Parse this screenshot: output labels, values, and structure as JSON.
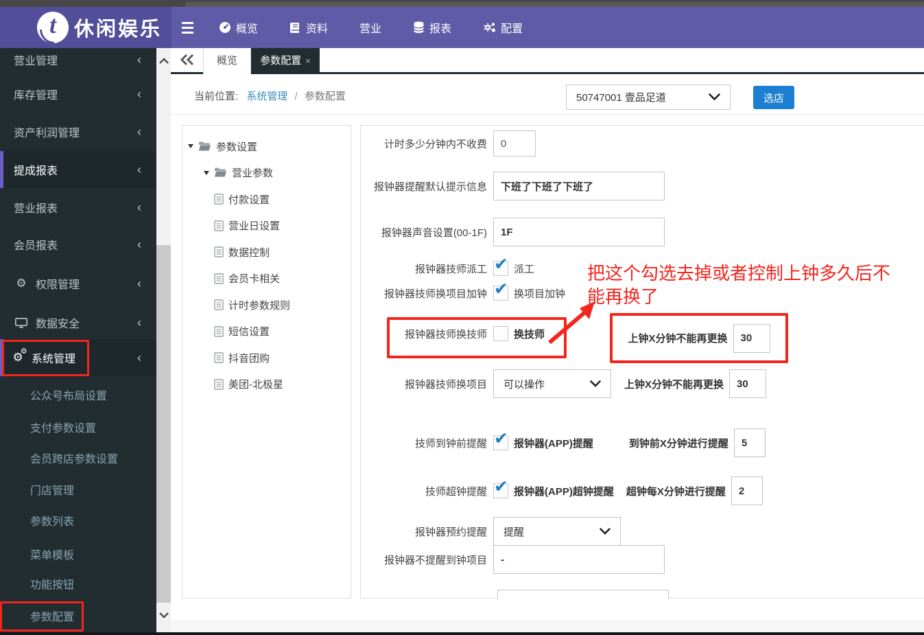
{
  "navbar": {
    "brand": "休闲娱乐",
    "items": [
      {
        "label": "概览",
        "icon": "dashboard-icon"
      },
      {
        "label": "资料",
        "icon": "book-icon"
      },
      {
        "label": "营业",
        "icon": ""
      },
      {
        "label": "报表",
        "icon": "database-icon"
      },
      {
        "label": "配置",
        "icon": "gears-icon"
      }
    ]
  },
  "sidebar": {
    "items": [
      {
        "label": "营业管理"
      },
      {
        "label": "库存管理"
      },
      {
        "label": "资产利润管理"
      },
      {
        "label": "提成报表",
        "active": true
      },
      {
        "label": "营业报表"
      },
      {
        "label": "会员报表"
      },
      {
        "label": "权限管理",
        "icon": "gear-icon"
      },
      {
        "label": "数据安全",
        "icon": "monitor-icon"
      },
      {
        "label": "系统管理",
        "icon": "gears-icon",
        "active": true,
        "highlighted": true
      }
    ],
    "chevron": "‹",
    "submenu": [
      {
        "label": "公众号布局设置"
      },
      {
        "label": "支付参数设置"
      },
      {
        "label": "会员跨店参数设置"
      },
      {
        "label": "门店管理"
      },
      {
        "label": "参数列表"
      },
      {
        "label": "菜单模板"
      },
      {
        "label": "功能按钮"
      },
      {
        "label": "参数配置",
        "highlighted": true
      }
    ]
  },
  "tabs": {
    "tab1": {
      "label": "概览"
    },
    "tab2": {
      "label": "参数配置",
      "close": "×",
      "active": true
    }
  },
  "breadcrumb": {
    "prefix": "当前位置:",
    "link": "系统管理",
    "separator": "/",
    "current": "参数配置"
  },
  "store": {
    "selected": "50747001 壹品足道",
    "button": "选店"
  },
  "tree": {
    "root": "参数设置",
    "group": "营业参数",
    "leaves": [
      "付款设置",
      "营业日设置",
      "数据控制",
      "会员卡相关",
      "计时参数规则",
      "短信设置",
      "抖音团购",
      "美团-北极星"
    ]
  },
  "form": {
    "free_minutes": {
      "label": "计时多少分钟内不收费",
      "value": "0"
    },
    "default_message": {
      "label": "报钟器提醒默认提示信息",
      "value": "下班了下班了下班了"
    },
    "sound": {
      "label": "报钟器声音设置(00-1F)",
      "value": "1F"
    },
    "dispatch": {
      "label": "报钟器技师派工",
      "checkbox": "派工",
      "checked": true
    },
    "change_item_add": {
      "label": "报钟器技师换项目加钟",
      "checkbox": "换项目加钟",
      "checked": true
    },
    "change_tech": {
      "label": "报钟器技师换技师",
      "checkbox": "换技师",
      "checked": false
    },
    "change_tech_limit": {
      "label": "上钟X分钟不能再更换",
      "value": "30"
    },
    "change_item": {
      "label": "报钟器技师换项目",
      "select": "可以操作",
      "limit_label": "上钟X分钟不能再更换",
      "limit_value": "30"
    },
    "pre_remind": {
      "label": "技师到钟前提醒",
      "checkbox": "报钟器(APP)提醒",
      "checked": true,
      "minutes_label": "到钟前X分钟进行提醒",
      "minutes_value": "5"
    },
    "over_remind": {
      "label": "技师超钟提醒",
      "checkbox": "报钟器(APP)超钟提醒",
      "checked": true,
      "minutes_label": "超钟每X分钟进行提醒",
      "minutes_value": "2"
    },
    "booking_remind": {
      "label": "报钟器预约提醒",
      "select": "提醒"
    },
    "no_remind_items": {
      "label": "报钟器不提醒到钟项目",
      "value": "-"
    }
  },
  "annotation": {
    "line1": "把这个勾选去掉或者控制上钟多久后不",
    "line2": "能再换了"
  },
  "colors": {
    "navbar": "#5f5ba6",
    "sidebar": "#222d32",
    "accent_purple": "#6b5fc5",
    "annotation_red": "#f3261d",
    "link_blue": "#3c8dbc",
    "button_blue": "#1c7fd2",
    "check_blue": "#1f7ec2"
  }
}
